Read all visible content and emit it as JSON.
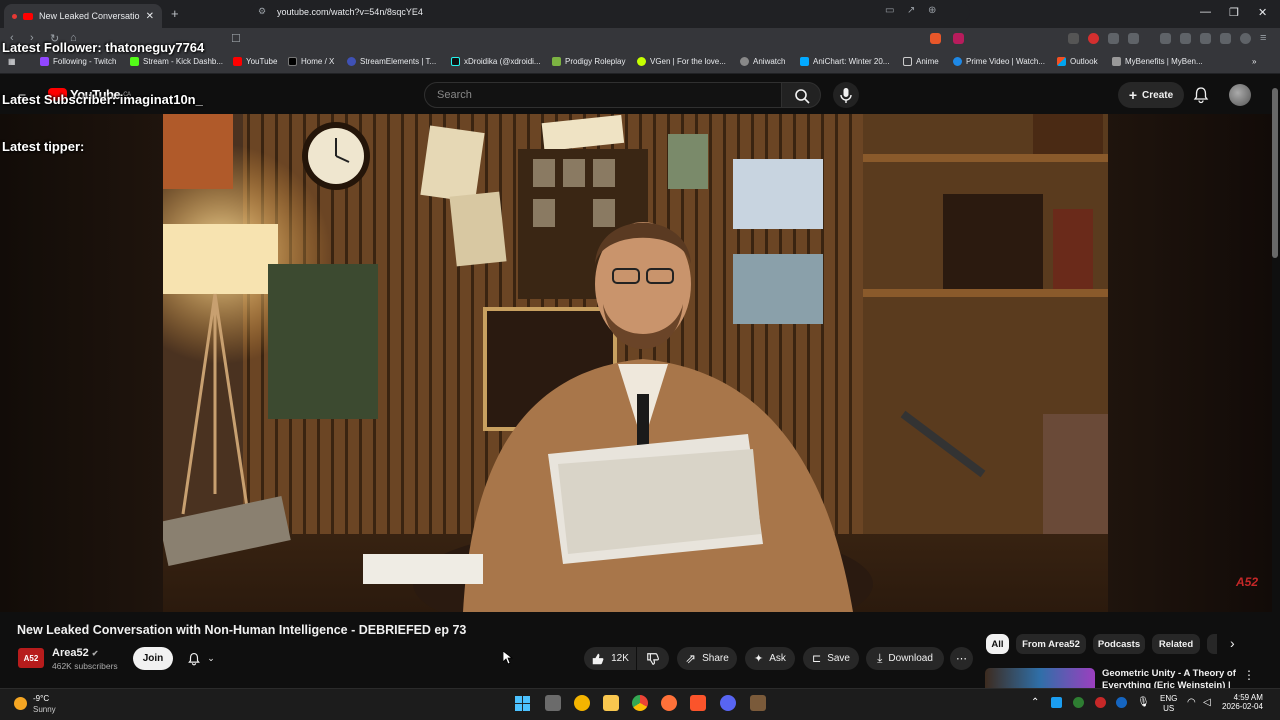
{
  "browser": {
    "tab_title": "New Leaked Conversation wi",
    "url": "youtube.com/watch?v=54n/8sqcYE4",
    "bookmarks": [
      "Following - Twitch",
      "Stream - Kick Dashb...",
      "YouTube",
      "Home / X",
      "StreamElements | T...",
      "xDroidika (@xdroidi...",
      "Prodigy Roleplay",
      "VGen | For the love...",
      "Aniwatch",
      "AniChart: Winter 20...",
      "Anime",
      "Prime Video | Watch...",
      "Outlook",
      "MyBenefits | MyBen..."
    ]
  },
  "overlay": {
    "follower": "Latest Follower: thatoneguy7764",
    "subscriber": "Latest Subscriber: imaginat10n_",
    "tipper": "Latest tipper:"
  },
  "youtube": {
    "logo_text": "YouTube",
    "region": "CA",
    "search_placeholder": "Search",
    "create_label": "Create",
    "video_title": "New Leaked Conversation with Non-Human Intelligence - DEBRIEFED ep 73",
    "channel_badge": "A52",
    "channel_name": "Area52",
    "subscribers": "462K subscribers",
    "join_label": "Join",
    "likes": "12K",
    "share_label": "Share",
    "ask_label": "Ask",
    "save_label": "Save",
    "download_label": "Download",
    "watermark": "A52",
    "chips": [
      "All",
      "From Area52",
      "Podcasts",
      "Related"
    ],
    "related_title": "Geometric Unity - A Theory of Everything (Eric Weinstein) | AI..."
  },
  "taskbar": {
    "temperature": "-9°C",
    "condition": "Sunny",
    "lang_top": "ENG",
    "lang_bottom": "US",
    "time": "4:59 AM",
    "date": "2026-02-04"
  }
}
